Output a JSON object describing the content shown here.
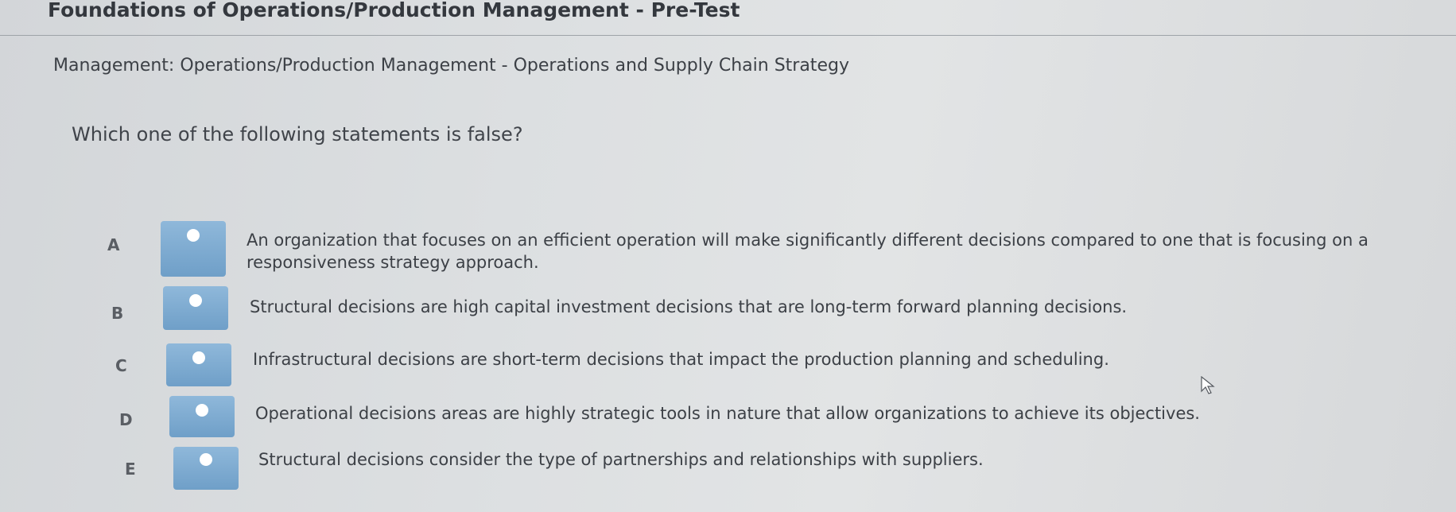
{
  "header": {
    "title": "Foundations of Operations/Production Management - Pre-Test",
    "subtitle": "Management: Operations/Production Management - Operations and Supply Chain Strategy"
  },
  "question": {
    "text": "Which one of the following statements is false?"
  },
  "options": [
    {
      "letter": "A",
      "text": "An organization that focuses on an efficient operation will make significantly different decisions compared to one that is focusing on a responsiveness strategy approach."
    },
    {
      "letter": "B",
      "text": "Structural decisions are high capital investment decisions that are long-term forward planning decisions."
    },
    {
      "letter": "C",
      "text": "Infrastructural decisions are short-term decisions that impact the production planning and scheduling."
    },
    {
      "letter": "D",
      "text": "Operational decisions areas are highly strategic tools in nature that allow organizations to achieve its objectives."
    },
    {
      "letter": "E",
      "text": "Structural decisions consider the type of partnerships and relationships with suppliers."
    }
  ],
  "colors": {
    "button": "#7aa8d0",
    "dot": "#ffffff",
    "text": "#3c4046"
  },
  "icons": {
    "cursor": "mouse-pointer-icon"
  }
}
